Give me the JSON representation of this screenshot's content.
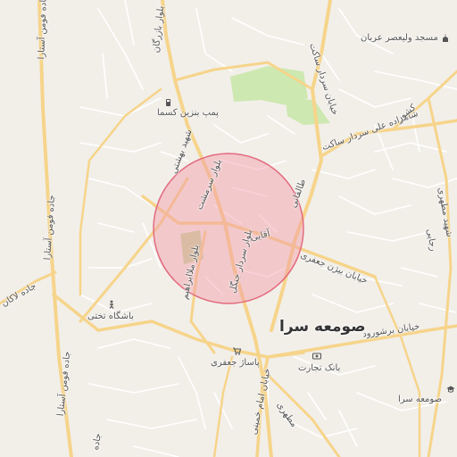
{
  "map": {
    "colors": {
      "land": "#f2efe9",
      "major_road": "#f6d48a",
      "minor_road": "#ffffff",
      "park": "#cde8b0",
      "circle_fill": "#f29aa6",
      "circle_stroke": "#e36b7e"
    },
    "town_label": "صومعه سرا",
    "road_labels": {
      "jade_fuman_astara_top": "جاده فومن آستارا",
      "jade_fuman_astara_mid": "جاده فومن آستارا",
      "jade_fuman_astara_low": "جاده فومن آستارا",
      "jade_lakan": "جاده لاکان",
      "bolvar_bazargan": "بلوار بازرگان",
      "bolvar_sardar_jangal": "بلوار سردار جنگل",
      "bolvar_molla_ebrahim": "بلوار ملاابراهیم",
      "bolvar_sarmasht": "بلوار سرمشت",
      "kheyabanshahid_beheshti": "شهید بهشتی",
      "aqayi": "آقایی",
      "shahid_taleghani": "طالقانی",
      "bijan_jafari": "خیابان بیژن جعفری",
      "sattarkhan": "شاهزاده علی سردار ساکت",
      "sardar_saket": "خیابان سردار ساکت",
      "kashvar": "کشور",
      "borshurud": "خیابان برشورود",
      "imam_khomeini": "خیابان امام خمینی",
      "motahhari": "مطهری",
      "shahid_rajaei": "رجایی",
      "khayyam": "خیام",
      "imam_reza": "امام رضا",
      "right_edge": "شهید مطهری",
      "forqani": "فرقانی",
      "shahrak": "خیابان فرجام",
      "left_edge": "جاده",
      "far_right": "جاده آستانه"
    },
    "pois": {
      "mosque": "مسجد ولیعصر عربان",
      "gas": "پمپ بنزین کسما",
      "club": "باشگاه تختی",
      "shop": "پاساژ جعفری",
      "bank": "بانک تجارت",
      "school": "صومعه سرا"
    },
    "icons": {
      "mosque": "mosque-icon",
      "gas": "gas-station-icon",
      "club": "sports-club-icon",
      "shop": "shopping-icon",
      "bank": "bank-icon",
      "school": "school-icon"
    }
  }
}
